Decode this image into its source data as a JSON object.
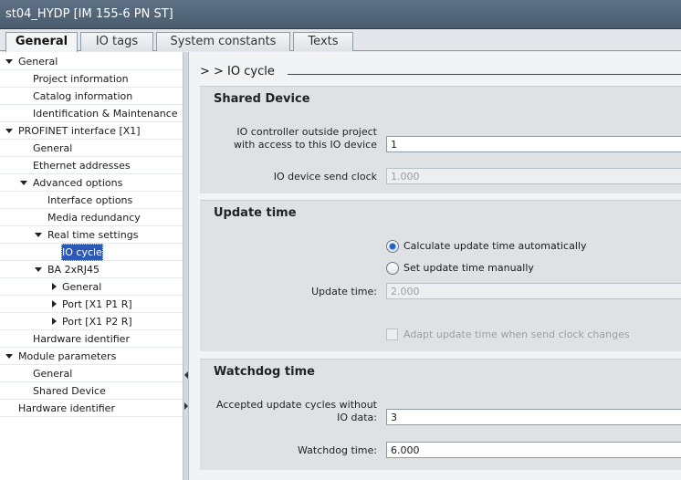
{
  "window": {
    "title": "st04_HYDP [IM 155-6 PN ST]"
  },
  "tabs": [
    {
      "label": "General",
      "active": true
    },
    {
      "label": "IO tags",
      "active": false
    },
    {
      "label": "System constants",
      "active": false
    },
    {
      "label": "Texts",
      "active": false
    }
  ],
  "tree": {
    "items": [
      {
        "label": "General",
        "expander": "down",
        "selected": false
      },
      {
        "label": "Project information",
        "expander": "none",
        "selected": false
      },
      {
        "label": "Catalog information",
        "expander": "none",
        "selected": false
      },
      {
        "label": "Identification & Maintenance",
        "expander": "none",
        "selected": false
      },
      {
        "label": "PROFINET interface [X1]",
        "expander": "down",
        "selected": false
      },
      {
        "label": "General",
        "expander": "none",
        "selected": false
      },
      {
        "label": "Ethernet addresses",
        "expander": "none",
        "selected": false
      },
      {
        "label": "Advanced options",
        "expander": "down",
        "selected": false
      },
      {
        "label": "Interface options",
        "expander": "none",
        "selected": false
      },
      {
        "label": "Media redundancy",
        "expander": "none",
        "selected": false
      },
      {
        "label": "Real time settings",
        "expander": "down",
        "selected": false
      },
      {
        "label": "IO cycle",
        "expander": "none",
        "selected": true
      },
      {
        "label": "BA 2xRJ45",
        "expander": "down",
        "selected": false
      },
      {
        "label": "General",
        "expander": "right",
        "selected": false
      },
      {
        "label": "Port [X1 P1 R]",
        "expander": "right",
        "selected": false
      },
      {
        "label": "Port [X1 P2 R]",
        "expander": "right",
        "selected": false
      },
      {
        "label": "Hardware identifier",
        "expander": "none",
        "selected": false
      },
      {
        "label": "Module parameters",
        "expander": "down",
        "selected": false
      },
      {
        "label": "General",
        "expander": "none",
        "selected": false
      },
      {
        "label": "Shared Device",
        "expander": "none",
        "selected": false
      },
      {
        "label": "Hardware identifier",
        "expander": "none",
        "selected": false
      }
    ]
  },
  "breadcrumb": {
    "text": "> >   IO cycle"
  },
  "shared_device": {
    "title": "Shared Device",
    "controller_label_line1": "IO controller outside project",
    "controller_label_line2": "with access to this IO device",
    "controller_value": "1",
    "send_clock_label": "IO device send clock",
    "send_clock_value": "1.000"
  },
  "update_time": {
    "title": "Update time",
    "radio_auto_label": "Calculate update time automatically",
    "radio_auto_checked": true,
    "radio_manual_label": "Set update time manually",
    "radio_manual_checked": false,
    "field_label": "Update time:",
    "field_value": "2.000",
    "adapt_label": "Adapt update time when send clock changes",
    "adapt_checked": false
  },
  "watchdog": {
    "title": "Watchdog time",
    "accepted_label_line1": "Accepted update cycles without",
    "accepted_label_line2": "IO data:",
    "accepted_value": "3",
    "watchdog_label": "Watchdog time:",
    "watchdog_value": "6.000"
  },
  "colors": {
    "titlebar": "#4f6275",
    "selection": "#2d59b6",
    "radio_dot": "#1e5fc9",
    "panel": "#dfe2e5"
  }
}
